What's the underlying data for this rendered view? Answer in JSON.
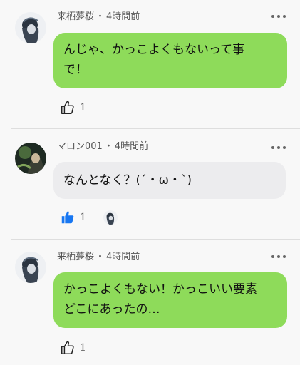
{
  "comments": [
    {
      "author": "来栖夢桜",
      "time": "4時間前",
      "text_lines": [
        "んじゃ、かっこよくもないって事",
        "で！"
      ],
      "likes": "1",
      "liked": false
    },
    {
      "author": "マロン001",
      "time": "4時間前",
      "text_lines": [
        "なんとなく？(´・ω・`)"
      ],
      "likes": "1",
      "liked": true
    },
    {
      "author": "来栖夢桜",
      "time": "4時間前",
      "text_lines": [
        "かっこよくもない！かっこいい要素",
        "どこにあったの…"
      ],
      "likes": "1",
      "liked": false
    }
  ],
  "separator": "・",
  "colors": {
    "bubble_green": "#8edb5a",
    "bubble_grey": "#ececee",
    "like_active": "#1877f2",
    "like_inactive": "#222222",
    "background": "#f8f8f8"
  },
  "icons": {
    "like": "thumbs-up-icon",
    "more": "more-horizontal-icon"
  }
}
